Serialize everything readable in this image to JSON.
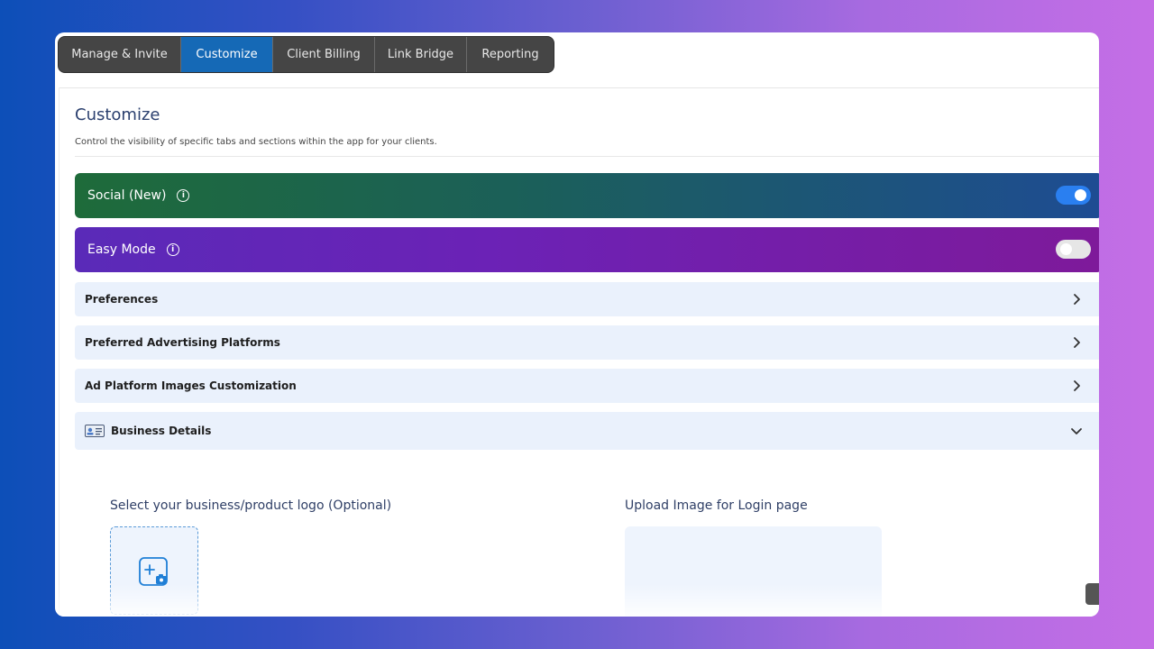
{
  "tabs": [
    {
      "label": "Manage & Invite"
    },
    {
      "label": "Customize"
    },
    {
      "label": "Client Billing"
    },
    {
      "label": "Link Bridge"
    },
    {
      "label": "Reporting"
    }
  ],
  "active_tab": "Customize",
  "page": {
    "title": "Customize",
    "subtitle": "Control the visibility of specific tabs and sections within the app for your clients."
  },
  "banners": {
    "social": {
      "label": "Social (New)",
      "enabled": true
    },
    "easy_mode": {
      "label": "Easy Mode",
      "enabled": false
    }
  },
  "accordions": [
    {
      "label": "Preferences",
      "expanded": false
    },
    {
      "label": "Preferred Advertising Platforms",
      "expanded": false
    },
    {
      "label": "Ad Platform Images Customization",
      "expanded": false
    },
    {
      "label": "Business Details",
      "expanded": true
    }
  ],
  "business_details": {
    "logo_label": "Select your business/product logo (Optional)",
    "login_image_label": "Upload Image for Login page"
  },
  "icons": {
    "info": "info-icon",
    "chevron_right": "chevron-right-icon",
    "chevron_down": "chevron-down-icon",
    "business_card": "id-card-icon",
    "add_photo": "add-photo-icon"
  },
  "colors": {
    "active_tab": "#1569b6",
    "toggle_on": "#2a7ff0",
    "accordion_bg": "#eaf1fc"
  }
}
